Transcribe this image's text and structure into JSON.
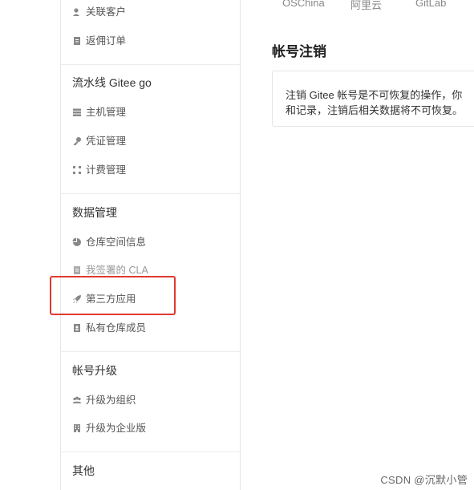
{
  "top_tabs": [
    "OSChina",
    "阿里云",
    "GitLab"
  ],
  "sidebar": {
    "partner_items": [
      {
        "icon": "user-icon",
        "label": "关联客户"
      },
      {
        "icon": "receipt-icon",
        "label": "返佣订单"
      }
    ],
    "pipeline": {
      "title": "流水线 Gitee go",
      "items": [
        {
          "icon": "server-icon",
          "label": "主机管理"
        },
        {
          "icon": "key-icon",
          "label": "凭证管理"
        },
        {
          "icon": "grid-dots-icon",
          "label": "计费管理"
        }
      ]
    },
    "data_management": {
      "title": "数据管理",
      "items": [
        {
          "icon": "pie-chart-icon",
          "label": "仓库空间信息"
        },
        {
          "icon": "document-icon",
          "label": "我签署的 CLA"
        },
        {
          "icon": "rocket-icon",
          "label": "第三方应用"
        },
        {
          "icon": "member-card-icon",
          "label": "私有仓库成员"
        }
      ]
    },
    "account_upgrade": {
      "title": "帐号升级",
      "items": [
        {
          "icon": "group-icon",
          "label": "升级为组织"
        },
        {
          "icon": "building-icon",
          "label": "升级为企业版"
        }
      ]
    },
    "other": {
      "title": "其他"
    }
  },
  "main": {
    "title": "帐号注销",
    "notice_line1": "注销 Gitee 帐号是不可恢复的操作，你",
    "notice_line2": "和记录，注销后相关数据将不可恢复。"
  },
  "watermark": "CSDN @沉默小管",
  "colors": {
    "highlight": "#e0392f",
    "border": "#e6e6e6"
  }
}
